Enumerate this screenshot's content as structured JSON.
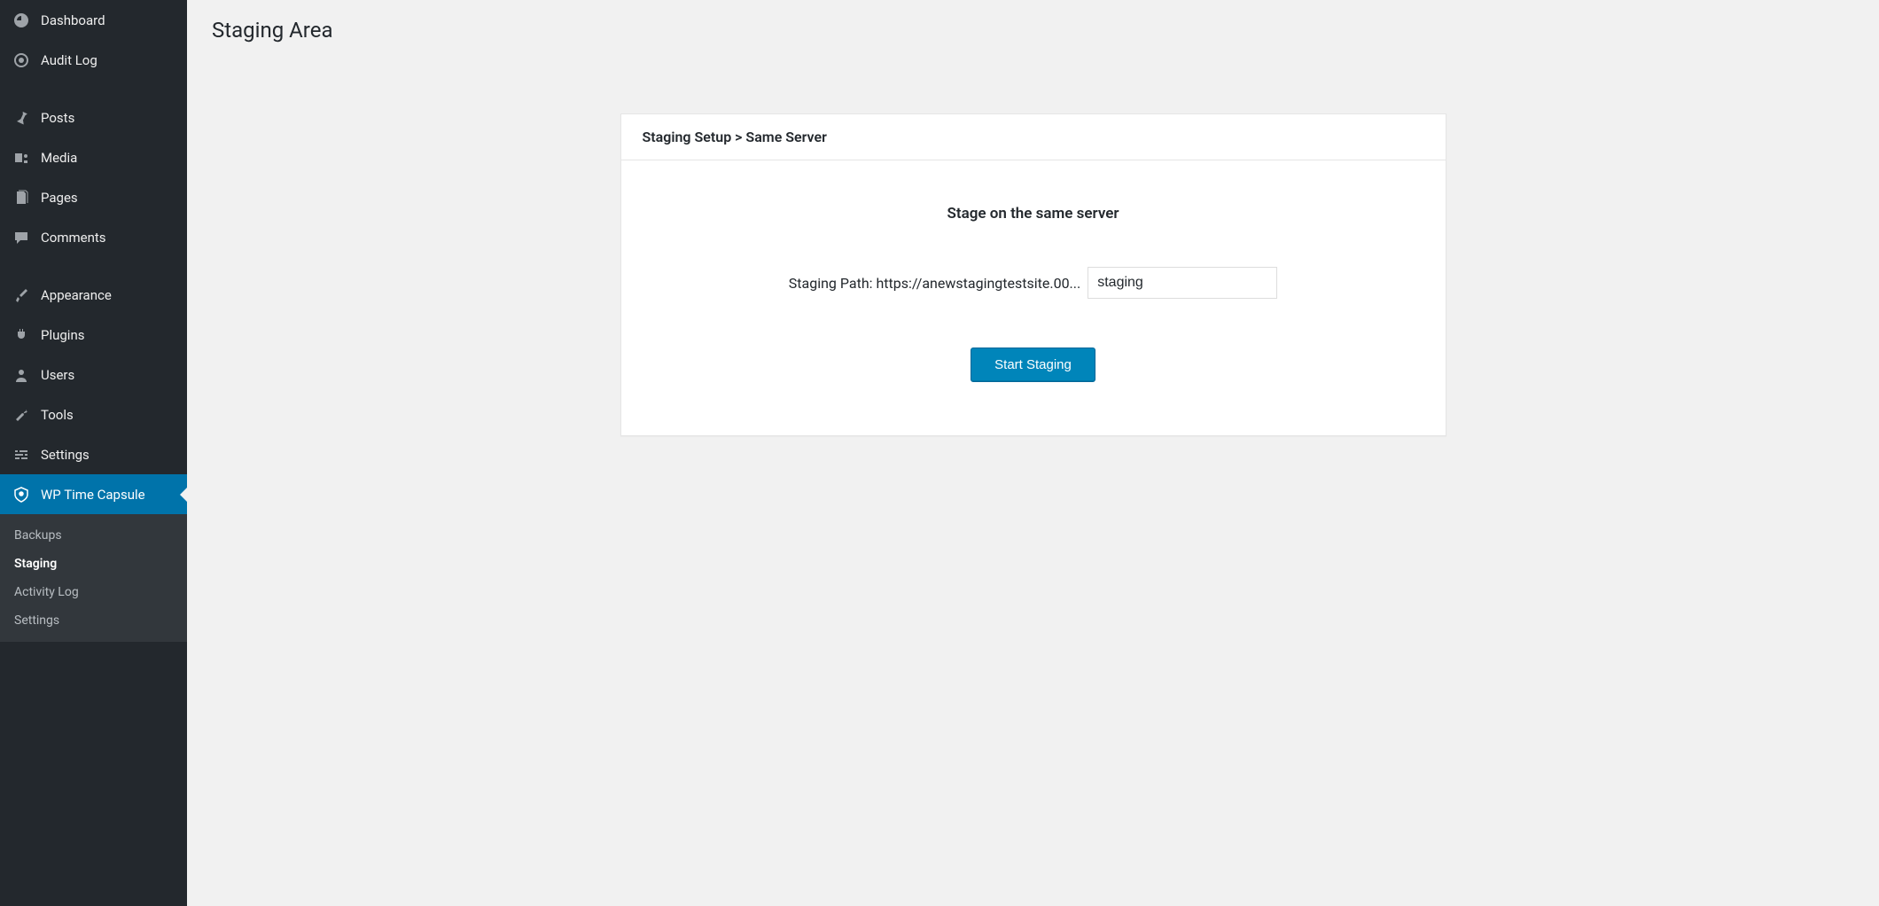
{
  "sidebar": {
    "items": [
      {
        "label": "Dashboard",
        "icon": "dashboard"
      },
      {
        "label": "Audit Log",
        "icon": "audit"
      },
      {
        "label": "Posts",
        "icon": "pin"
      },
      {
        "label": "Media",
        "icon": "media"
      },
      {
        "label": "Pages",
        "icon": "pages"
      },
      {
        "label": "Comments",
        "icon": "comments"
      },
      {
        "label": "Appearance",
        "icon": "brush"
      },
      {
        "label": "Plugins",
        "icon": "plug"
      },
      {
        "label": "Users",
        "icon": "user"
      },
      {
        "label": "Tools",
        "icon": "wrench"
      },
      {
        "label": "Settings",
        "icon": "sliders"
      },
      {
        "label": "WP Time Capsule",
        "icon": "shield"
      }
    ],
    "subitems": [
      {
        "label": "Backups"
      },
      {
        "label": "Staging"
      },
      {
        "label": "Activity Log"
      },
      {
        "label": "Settings"
      }
    ]
  },
  "main": {
    "pageTitle": "Staging Area",
    "card": {
      "header": "Staging Setup > Same Server",
      "subtitle": "Stage on the same server",
      "stagingPathLabel": "Staging Path: https://anewstagingtestsite.00...",
      "stagingPathValue": "staging",
      "buttonLabel": "Start Staging"
    }
  }
}
